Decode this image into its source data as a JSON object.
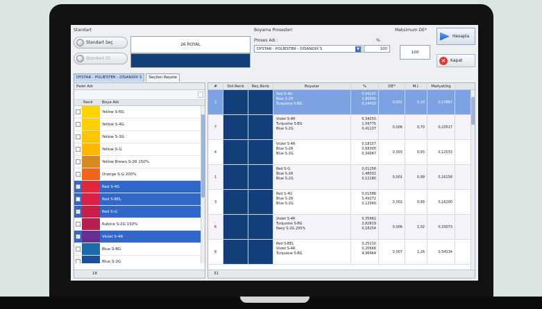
{
  "standard": {
    "section_label": "Standart",
    "select_button": "Standart Seç",
    "disabled_button": "Standart Ol.",
    "name": "26 ROYAL",
    "swatch_color": "#123f7a"
  },
  "process": {
    "section_label": "Boyama Prosesleri",
    "name_label": "Proses Adı :",
    "pct_label": "%",
    "selected": "DYSTAR - POLİESTER - DİSANDİX S",
    "pct_value": "100"
  },
  "max_de": {
    "label": "Maksimum DE*",
    "value": "100"
  },
  "buttons": {
    "calculate": "Hesapla",
    "close": "Kapat"
  },
  "tabs": [
    {
      "label": "DYSTAR - POLİESTER - DİSANDİX S",
      "active": true
    },
    {
      "label": "Seçilen Reçete",
      "active": false
    }
  ],
  "left_panel": {
    "title": "Palet Adı",
    "columns": [
      "Renk",
      "Boya Adı"
    ],
    "footer_count": "18",
    "items": [
      {
        "name": "Yellow S-6G",
        "color": "#ffd400",
        "checked": false,
        "selected": false
      },
      {
        "name": "Yellow S-4G",
        "color": "#ffcf00",
        "checked": false,
        "selected": false
      },
      {
        "name": "Yellow S-3G",
        "color": "#ffc400",
        "checked": false,
        "selected": false
      },
      {
        "name": "Yellow S-G",
        "color": "#ffb800",
        "checked": false,
        "selected": false
      },
      {
        "name": "Yellow Brown S-2R 150%",
        "color": "#d98a1e",
        "checked": false,
        "selected": false
      },
      {
        "name": "Orange S-G 200%",
        "color": "#f0651b",
        "checked": false,
        "selected": false
      },
      {
        "name": "Red S-4G",
        "color": "#e0263b",
        "checked": true,
        "selected": true
      },
      {
        "name": "Red S-BEL",
        "color": "#d81f45",
        "checked": false,
        "selected": true
      },
      {
        "name": "Red S-G",
        "color": "#c81f4a",
        "checked": true,
        "selected": true
      },
      {
        "name": "Rubine S-2G 150%",
        "color": "#b81e52",
        "checked": false,
        "selected": false
      },
      {
        "name": "Violet S-4R",
        "color": "#6b2d8c",
        "checked": true,
        "selected": true
      },
      {
        "name": "Blue S-BG",
        "color": "#1a6aa6",
        "checked": false,
        "selected": false
      },
      {
        "name": "Blue S-2G",
        "color": "#1f4f9a",
        "checked": false,
        "selected": false
      }
    ]
  },
  "right_panel": {
    "columns": [
      "#",
      "Std.Renk",
      "Reç.Renk",
      "Boyalar",
      "%",
      "DE*",
      "M.I.",
      "Maliyet/kg"
    ],
    "footer_count": "31",
    "rows": [
      {
        "num": "2",
        "dyes": [
          "Red S-4G",
          "Blue S-2R",
          "Turquoise S-BG"
        ],
        "pcts": [
          "0,04107",
          "1,90930",
          "0,24410"
        ],
        "de": "0,001",
        "mi": "0,10",
        "cost": "0,17867",
        "selected": true
      },
      {
        "num": "7",
        "dyes": [
          "Violet S-4R",
          "Turquoise S-BG",
          "Blue S-2G"
        ],
        "pcts": [
          "0,34255",
          "1,59775",
          "0,41137"
        ],
        "de": "0,006",
        "mi": "0,70",
        "cost": "0,23517",
        "selected": false
      },
      {
        "num": "4",
        "dyes": [
          "Violet S-4R",
          "Blue S-2R",
          "Blue S-2G"
        ],
        "pcts": [
          "0,18157",
          "0,68305",
          "0,34067"
        ],
        "de": "0,003",
        "mi": "0,93",
        "cost": "0,12033",
        "selected": false
      },
      {
        "num": "1",
        "dyes": [
          "Red S-G",
          "Blue S-2R",
          "Blue S-2G"
        ],
        "pcts": [
          "0,01256",
          "1,48032",
          "0,12180"
        ],
        "de": "0,001",
        "mi": "0,99",
        "cost": "0,16158",
        "selected": false
      },
      {
        "num": "3",
        "dyes": [
          "Red S-4G",
          "Blue S-2R",
          "Blue S-2G"
        ],
        "pcts": [
          "0,01588",
          "1,49272",
          "0,12040"
        ],
        "de": "0,002",
        "mi": "0,99",
        "cost": "0,16290",
        "selected": false
      },
      {
        "num": "6",
        "dyes": [
          "Violet S-4R",
          "Turquoise S-BG",
          "Navy S-2G 200%"
        ],
        "pcts": [
          "0,35662",
          "2,82819",
          "0,16254"
        ],
        "de": "0,006",
        "mi": "1,02",
        "cost": "0,33073",
        "selected": false
      },
      {
        "num": "8",
        "dyes": [
          "Red S-BEL",
          "Violet S-4R",
          "Turquoise S-BG"
        ],
        "pcts": [
          "0,25210",
          "0,20666",
          "4,96464"
        ],
        "de": "0,007",
        "mi": "1,26",
        "cost": "0,54234",
        "selected": false
      }
    ]
  }
}
